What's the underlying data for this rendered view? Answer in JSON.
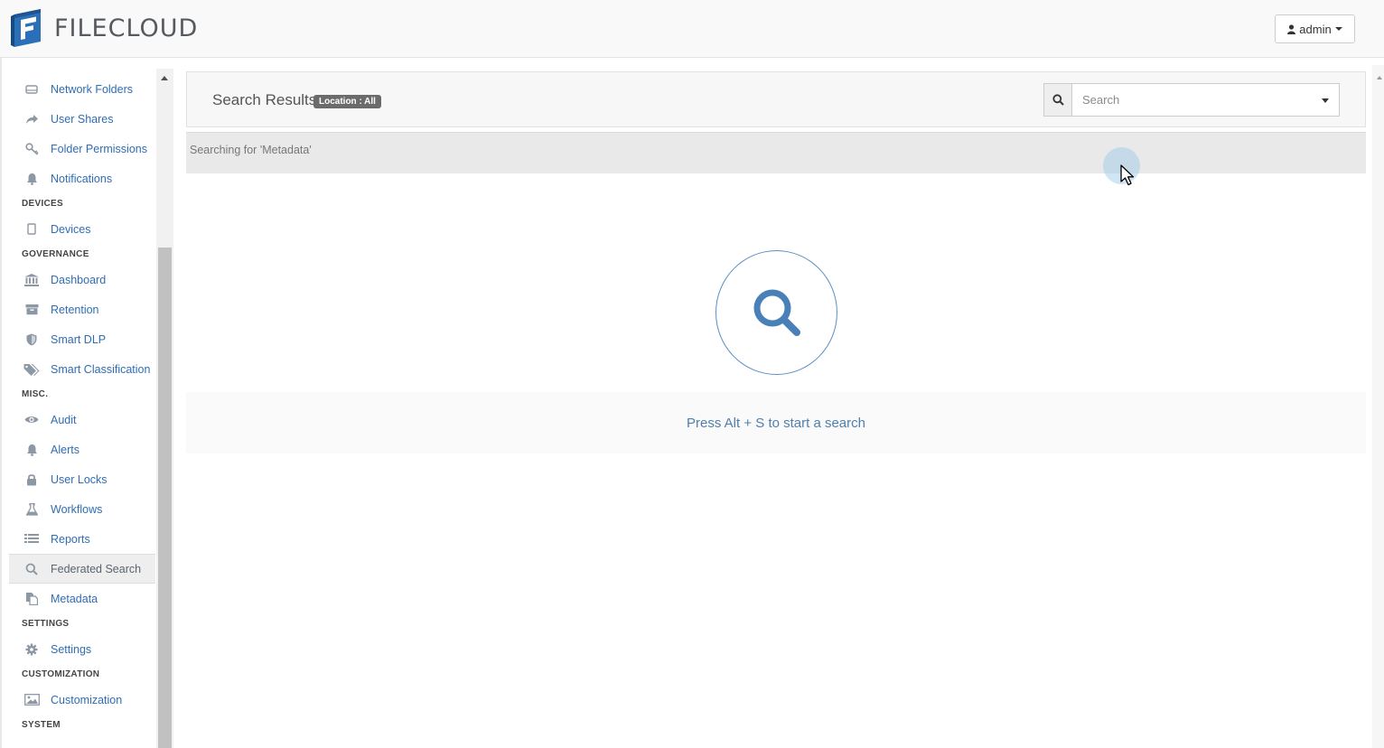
{
  "app": {
    "brand": "FILECLOUD",
    "user_label": "admin"
  },
  "colors": {
    "link": "#2f6db5",
    "brand_blue": "#2a6fb8",
    "accent_circle": "#5a8fc4"
  },
  "sidebar": {
    "items": [
      {
        "type": "item",
        "label": "Network Folders",
        "icon": "drive-icon"
      },
      {
        "type": "item",
        "label": "User Shares",
        "icon": "share-icon"
      },
      {
        "type": "item",
        "label": "Folder Permissions",
        "icon": "key-icon"
      },
      {
        "type": "item",
        "label": "Notifications",
        "icon": "bell-icon"
      },
      {
        "type": "section",
        "label": "DEVICES"
      },
      {
        "type": "item",
        "label": "Devices",
        "icon": "device-icon"
      },
      {
        "type": "section",
        "label": "GOVERNANCE"
      },
      {
        "type": "item",
        "label": "Dashboard",
        "icon": "bank-icon"
      },
      {
        "type": "item",
        "label": "Retention",
        "icon": "archive-icon"
      },
      {
        "type": "item",
        "label": "Smart DLP",
        "icon": "shield-icon"
      },
      {
        "type": "item",
        "label": "Smart Classification",
        "icon": "tags-icon"
      },
      {
        "type": "section",
        "label": "MISC."
      },
      {
        "type": "item",
        "label": "Audit",
        "icon": "eye-icon"
      },
      {
        "type": "item",
        "label": "Alerts",
        "icon": "bell-icon"
      },
      {
        "type": "item",
        "label": "User Locks",
        "icon": "lock-icon"
      },
      {
        "type": "item",
        "label": "Workflows",
        "icon": "flask-icon"
      },
      {
        "type": "item",
        "label": "Reports",
        "icon": "list-icon"
      },
      {
        "type": "item",
        "label": "Federated Search",
        "icon": "search-icon",
        "active": true
      },
      {
        "type": "item",
        "label": "Metadata",
        "icon": "copy-icon"
      },
      {
        "type": "section",
        "label": "SETTINGS"
      },
      {
        "type": "item",
        "label": "Settings",
        "icon": "gear-icon"
      },
      {
        "type": "section",
        "label": "CUSTOMIZATION"
      },
      {
        "type": "item",
        "label": "Customization",
        "icon": "image-icon"
      },
      {
        "type": "section",
        "label": "SYSTEM"
      }
    ]
  },
  "main": {
    "title": "Search Results",
    "location_badge": "Location : All",
    "search_placeholder": "Search",
    "status_text": "Searching for 'Metadata'",
    "hint": "Press Alt + S to start a search"
  }
}
